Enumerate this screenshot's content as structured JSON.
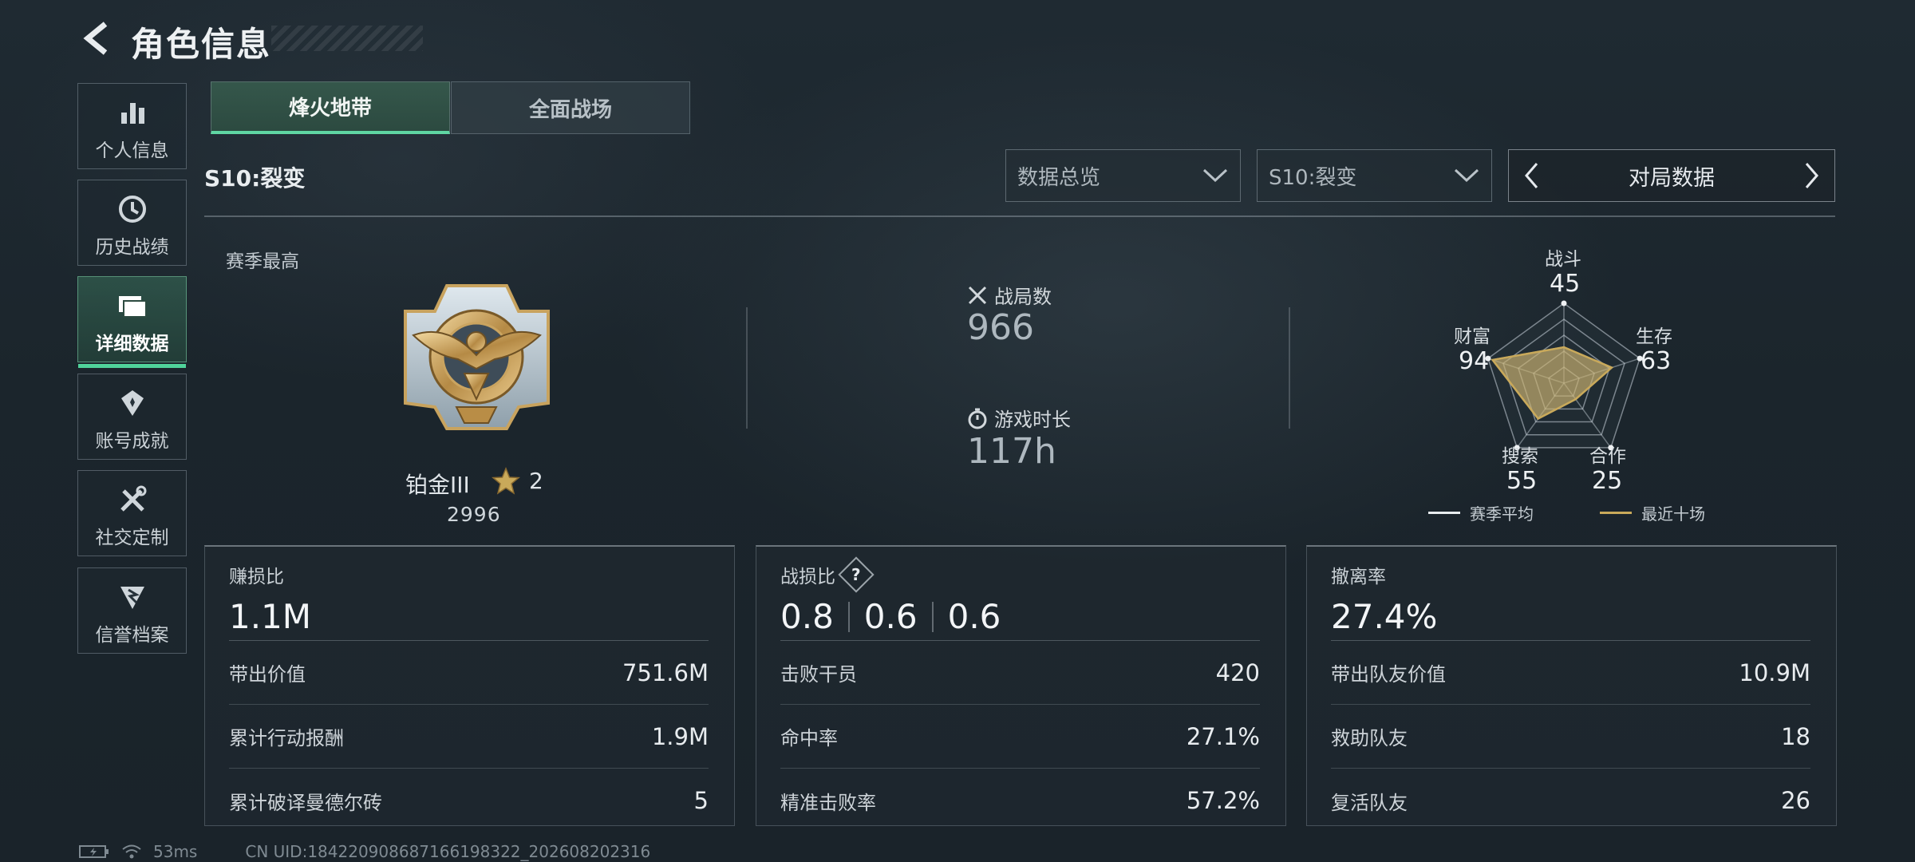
{
  "header": {
    "title": "角色信息"
  },
  "sidebar": {
    "items": [
      {
        "label": "个人信息",
        "icon": "bar-chart-icon"
      },
      {
        "label": "历史战绩",
        "icon": "history-icon"
      },
      {
        "label": "详细数据",
        "icon": "folder-icon"
      },
      {
        "label": "账号成就",
        "icon": "achievement-icon"
      },
      {
        "label": "社交定制",
        "icon": "tools-icon"
      },
      {
        "label": "信誉档案",
        "icon": "reputation-icon"
      }
    ],
    "active_index": 2
  },
  "tabs": [
    {
      "label": "烽火地带"
    },
    {
      "label": "全面战场"
    }
  ],
  "season_title": "S10:裂变",
  "filters": {
    "overview": "数据总览",
    "season": "S10:裂变",
    "pager_label": "对局数据"
  },
  "rank": {
    "season_high_label": "赛季最高",
    "name": "铂金III",
    "stars": "2",
    "score": "2996"
  },
  "middle_stats": {
    "matches_label": "战局数",
    "matches_value": "966",
    "playtime_label": "游戏时长",
    "playtime_value": "117h"
  },
  "radar": {
    "axes": [
      {
        "label": "战斗",
        "value": "45"
      },
      {
        "label": "生存",
        "value": "63"
      },
      {
        "label": "合作",
        "value": "25"
      },
      {
        "label": "搜索",
        "value": "55"
      },
      {
        "label": "财富",
        "value": "94"
      }
    ],
    "legend_season": "赛季平均",
    "legend_recent": "最近十场",
    "color_season": "#e8ecef",
    "color_recent": "#c9a95a"
  },
  "cards": [
    {
      "title": "赚损比",
      "main": "1.1M",
      "rows": [
        {
          "label": "带出价值",
          "value": "751.6M"
        },
        {
          "label": "累计行动报酬",
          "value": "1.9M"
        },
        {
          "label": "累计破译曼德尔砖",
          "value": "5"
        }
      ]
    },
    {
      "title": "战损比",
      "help": "?",
      "main_parts": [
        "0.8",
        "0.6",
        "0.6"
      ],
      "rows": [
        {
          "label": "击败干员",
          "value": "420"
        },
        {
          "label": "命中率",
          "value": "27.1%"
        },
        {
          "label": "精准击败率",
          "value": "57.2%"
        }
      ]
    },
    {
      "title": "撤离率",
      "main": "27.4%",
      "rows": [
        {
          "label": "带出队友价值",
          "value": "10.9M"
        },
        {
          "label": "救助队友",
          "value": "18"
        },
        {
          "label": "复活队友",
          "value": "26"
        }
      ]
    }
  ],
  "footer": {
    "ping": "53ms",
    "uid": "CN UID:1842209086871661983​22_202608202316"
  }
}
